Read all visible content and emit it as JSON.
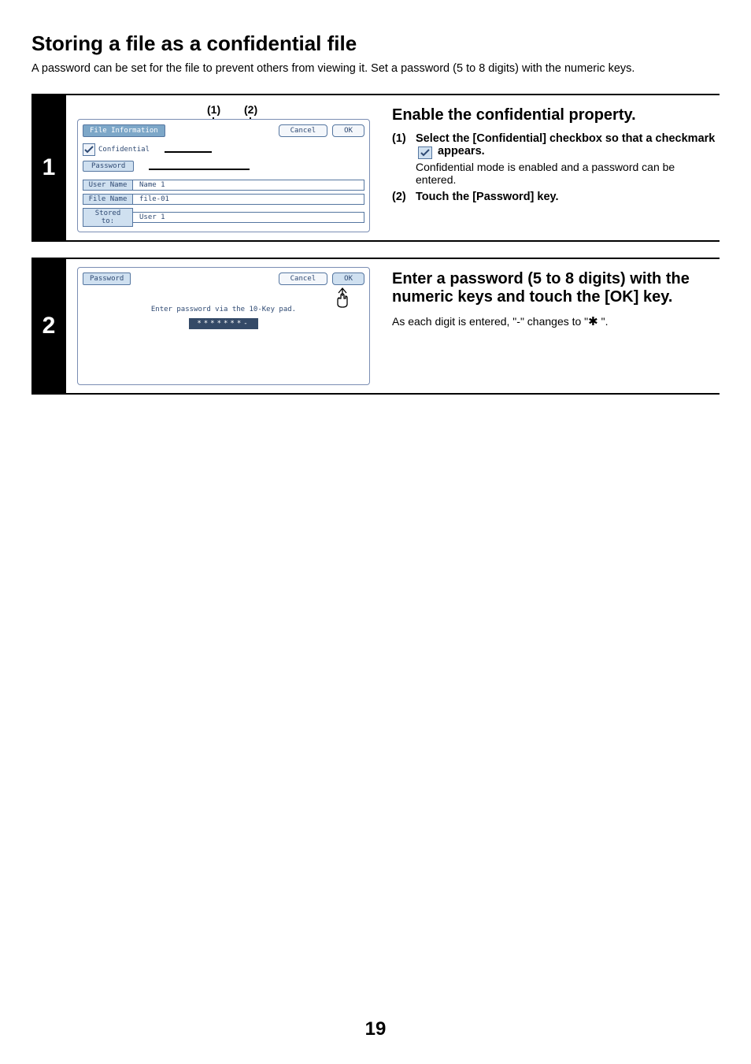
{
  "title": "Storing a file as a confidential file",
  "intro": "A password can be set for the file to prevent others from viewing it. Set a password (5 to 8 digits) with the numeric keys.",
  "page_number": "19",
  "steps": [
    {
      "num": "1",
      "callouts": [
        "(1)",
        "(2)"
      ],
      "panel": {
        "title": "File Information",
        "cancel": "Cancel",
        "ok": "OK",
        "confidential": "Confidential",
        "password": "Password",
        "fields": [
          {
            "label": "User Name",
            "value": "Name 1"
          },
          {
            "label": "File Name",
            "value": "file-01"
          },
          {
            "label": "Stored to:",
            "value": "User 1"
          }
        ]
      },
      "heading": "Enable the confidential property.",
      "substeps": [
        {
          "num": "(1)",
          "bold_before": "Select the [Confidential] checkbox so that a checkmark ",
          "bold_after": " appears.",
          "note": "Confidential mode is enabled and a password can be entered."
        },
        {
          "num": "(2)",
          "bold_before": "Touch the [Password] key."
        }
      ]
    },
    {
      "num": "2",
      "panel": {
        "title": "Password",
        "cancel": "Cancel",
        "ok": "OK",
        "instruction": "Enter password via the 10-Key pad.",
        "masked": "*******-"
      },
      "heading": "Enter a password (5 to 8 digits) with the numeric keys and touch the [OK] key.",
      "note_text": "As each digit is entered, \"-\" changes to \" \"."
    }
  ]
}
